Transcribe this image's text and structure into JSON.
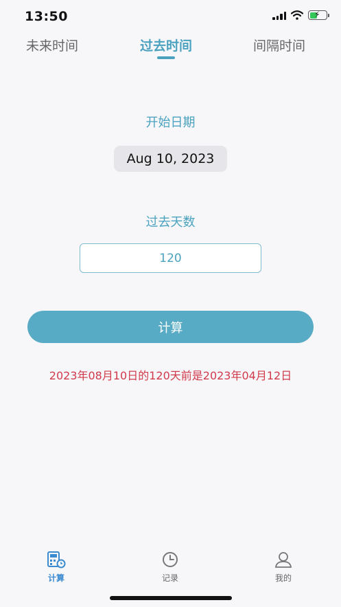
{
  "status_bar": {
    "time": "13:50"
  },
  "tabs": [
    {
      "label": "未来时间",
      "active": false
    },
    {
      "label": "过去时间",
      "active": true
    },
    {
      "label": "间隔时间",
      "active": false
    }
  ],
  "form": {
    "start_date_label": "开始日期",
    "start_date_value": "Aug 10, 2023",
    "days_label": "过去天数",
    "days_value": "120",
    "calculate_label": "计算"
  },
  "result": "2023年08月10日的120天前是2023年04月12日",
  "bottom_nav": [
    {
      "label": "计算",
      "icon": "calculator-icon",
      "active": true
    },
    {
      "label": "记录",
      "icon": "clock-icon",
      "active": false
    },
    {
      "label": "我的",
      "icon": "person-icon",
      "active": false
    }
  ],
  "colors": {
    "accent": "#4aa2bf",
    "button": "#58abc4",
    "result_text": "#d0394a",
    "active_nav": "#3b8bd0",
    "background": "#f7f7fa"
  }
}
